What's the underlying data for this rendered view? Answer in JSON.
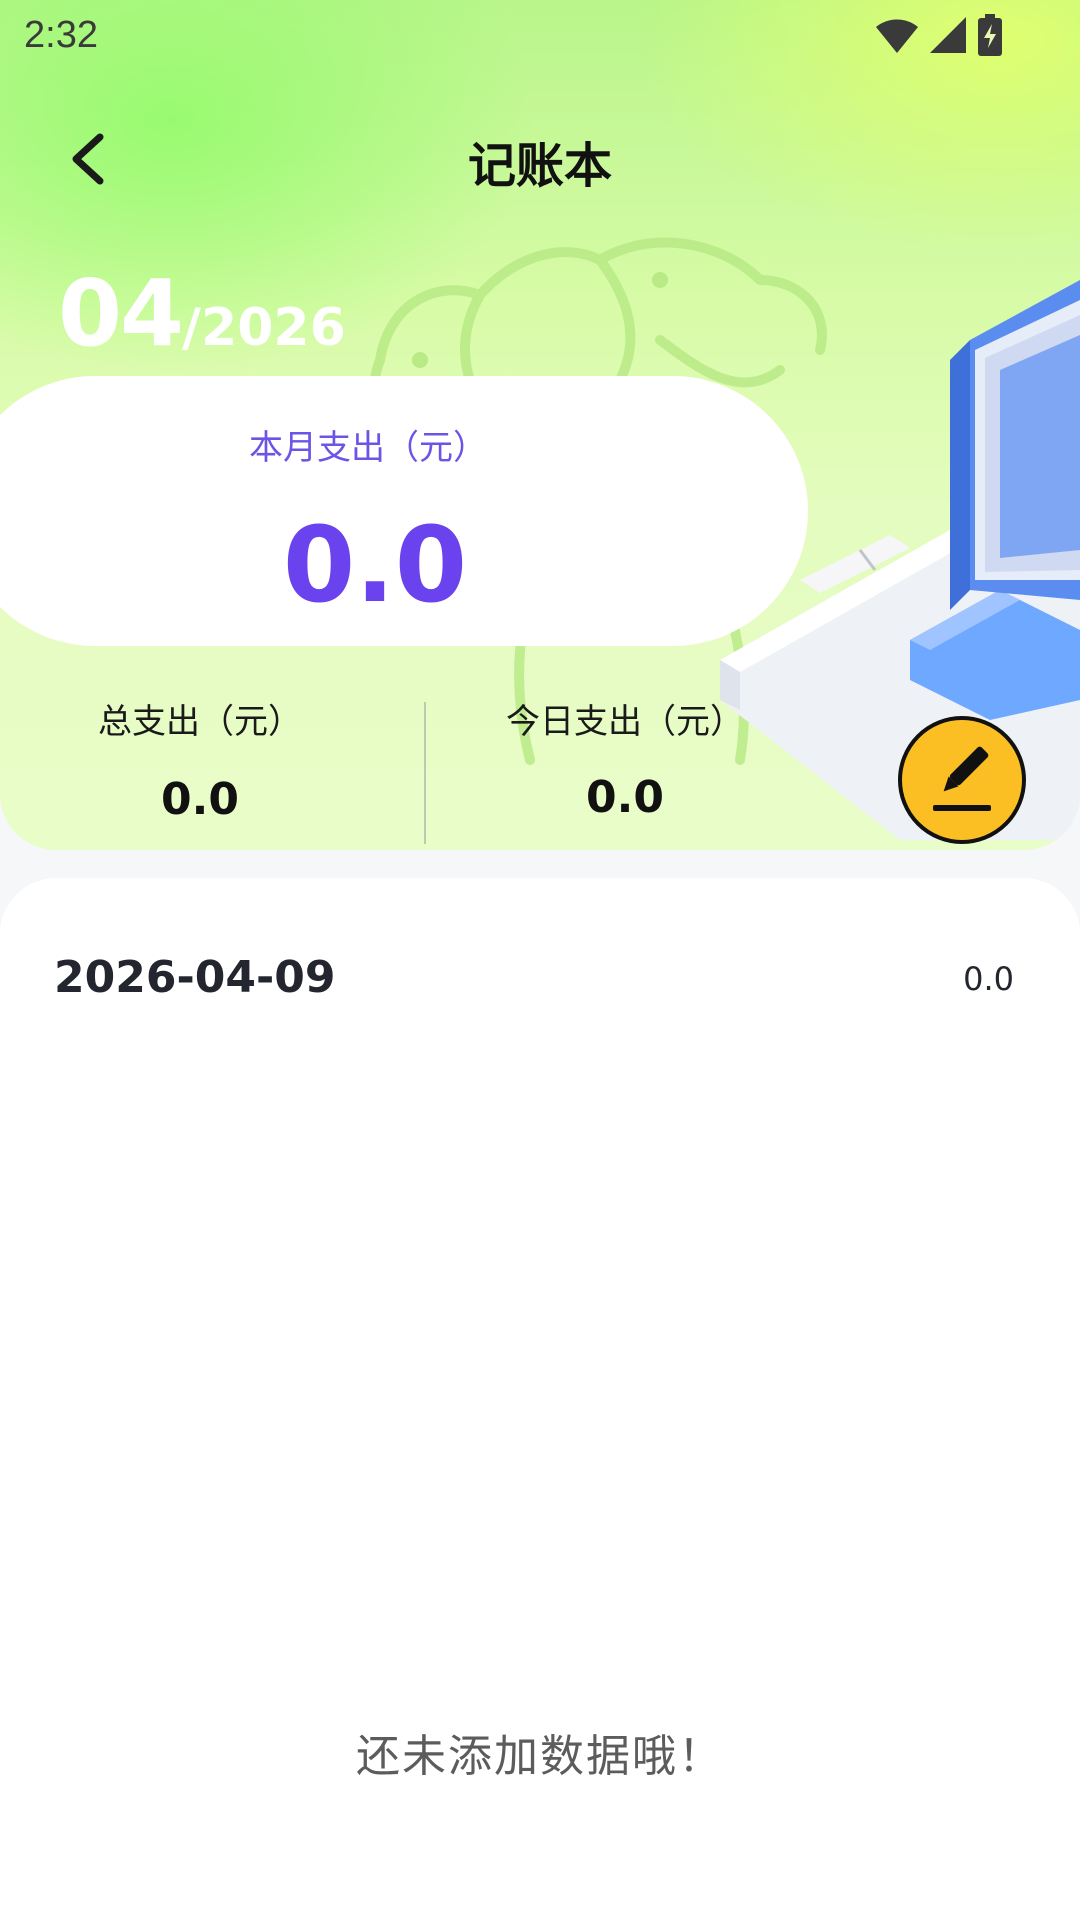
{
  "status_bar": {
    "time": "2:32"
  },
  "app_bar": {
    "title": "记账本",
    "back_icon": "chevron-left-icon"
  },
  "date": {
    "month": "04",
    "separator": "/",
    "year": "2026"
  },
  "month_summary": {
    "label": "本月支出（元）",
    "value": "0.0"
  },
  "stats": {
    "total_label": "总支出（元）",
    "total_value": "0.0",
    "today_label": "今日支出（元）",
    "today_value": "0.0"
  },
  "fab": {
    "icon": "pencil-icon"
  },
  "records": {
    "date": "2026-04-09",
    "amount": "0.0",
    "empty_message": "还未添加数据哦！"
  },
  "colors": {
    "accent_purple": "#6a43ee",
    "fab_yellow": "#fbbf24",
    "hero_green": "#b8f58a"
  }
}
